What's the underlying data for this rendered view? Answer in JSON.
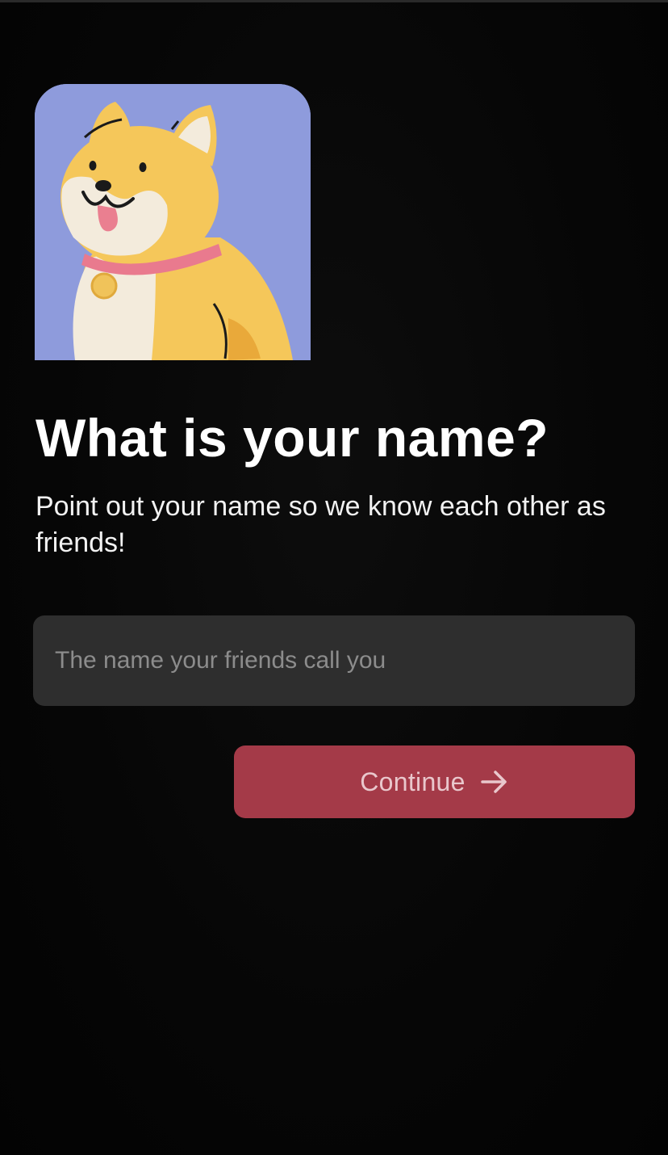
{
  "onboarding": {
    "avatar_icon": "shiba-dog-avatar-icon",
    "title": "What is your name?",
    "subtitle": "Point out your name so we know each other as friends!",
    "name_input": {
      "value": "",
      "placeholder": "The name your friends call you"
    },
    "continue_button": {
      "label": "Continue",
      "icon": "arrow-right-icon"
    }
  },
  "colors": {
    "background": "#050505",
    "avatar_background": "#8e9bdc",
    "input_background": "#2e2e2e",
    "button_background": "#a43a48",
    "button_text": "#e9c7cc",
    "title_text": "#ffffff"
  }
}
